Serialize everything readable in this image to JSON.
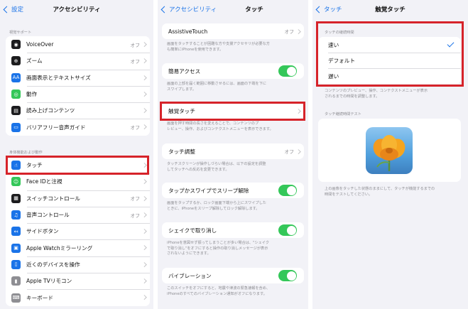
{
  "panel1": {
    "back": "設定",
    "title": "アクセシビリティ",
    "vision_header": "視覚サポート",
    "vision_items": [
      {
        "label": "VoiceOver",
        "value": "オフ",
        "color": "#1c1c1e",
        "icon": "voiceover-icon",
        "glyph": "◉"
      },
      {
        "label": "ズーム",
        "value": "オフ",
        "color": "#1c1c1e",
        "icon": "zoom-icon",
        "glyph": "⊕"
      },
      {
        "label": "画面表示とテキストサイズ",
        "value": "",
        "color": "#1a73e8",
        "icon": "text-size-icon",
        "glyph": "AA"
      },
      {
        "label": "動作",
        "value": "",
        "color": "#34c759",
        "icon": "motion-icon",
        "glyph": "◎"
      },
      {
        "label": "読み上げコンテンツ",
        "value": "",
        "color": "#1c1c1e",
        "icon": "spoken-content-icon",
        "glyph": "▤"
      },
      {
        "label": "バリアフリー音声ガイド",
        "value": "オフ",
        "color": "#1a73e8",
        "icon": "audio-description-icon",
        "glyph": "▭"
      }
    ],
    "physical_header": "身体機能および動作",
    "physical_items": [
      {
        "label": "タッチ",
        "value": "",
        "color": "#1a73e8",
        "icon": "touch-icon",
        "glyph": "☝"
      },
      {
        "label": "Face IDと注視",
        "value": "",
        "color": "#34c759",
        "icon": "face-id-icon",
        "glyph": "☺"
      },
      {
        "label": "スイッチコントロール",
        "value": "オフ",
        "color": "#1c1c1e",
        "icon": "switch-control-icon",
        "glyph": "▦"
      },
      {
        "label": "音声コントロール",
        "value": "オフ",
        "color": "#1a73e8",
        "icon": "voice-control-icon",
        "glyph": "♫"
      },
      {
        "label": "サイドボタン",
        "value": "",
        "color": "#1a73e8",
        "icon": "side-button-icon",
        "glyph": "↤"
      },
      {
        "label": "Apple Watchミラーリング",
        "value": "",
        "color": "#1a73e8",
        "icon": "watch-mirroring-icon",
        "glyph": "▣"
      },
      {
        "label": "近くのデバイスを操作",
        "value": "",
        "color": "#1a73e8",
        "icon": "nearby-devices-icon",
        "glyph": "▯"
      },
      {
        "label": "Apple TVリモコン",
        "value": "",
        "color": "#8e8e93",
        "icon": "tv-remote-icon",
        "glyph": "▮"
      },
      {
        "label": "キーボード",
        "value": "",
        "color": "#8e8e93",
        "icon": "keyboard-icon",
        "glyph": "⌨"
      }
    ]
  },
  "panel2": {
    "back": "アクセシビリティ",
    "title": "タッチ",
    "assistive_touch": {
      "label": "AssistiveTouch",
      "value": "オフ"
    },
    "assistive_touch_desc": [
      "画面をタッチすることが困難な方や支援アクセサリが必要な方",
      "も簡単にiPhoneを使用できます。"
    ],
    "reachability": {
      "label": "簡易アクセス"
    },
    "reachability_desc": [
      "画面の上部を届く範囲に移動させるには、画面の下端を下に",
      "スワイプします。"
    ],
    "haptic_touch": {
      "label": "触覚タッチ"
    },
    "haptic_touch_desc": [
      "画面を押す時間の長さを変えることで、コンテンツのプ",
      "レビュー、操作、およびコンテクストメニューを表示できます。"
    ],
    "touch_accommodations": {
      "label": "タッチ調整",
      "value": "オフ"
    },
    "touch_accommodations_desc": [
      "タッチスクリーンが操作しづらい場合は、以下の設定を調整",
      "してタッチへの反応を変更できます。"
    ],
    "tap_to_wake": {
      "label": "タップかスワイプでスリープ解除"
    },
    "tap_to_wake_desc": [
      "画面をタップするか、ロック画面下端から上にスワイプした",
      "ときに、iPhoneをスリープ解除してロック解除します。"
    ],
    "shake_to_undo": {
      "label": "シェイクで取り消し"
    },
    "shake_to_undo_desc": [
      "iPhoneを意図せず振ってしまうことが多い場合は、\"シェイク",
      "で取り消し\"をオフにすると操作の取り消しメッセージが表示",
      "されないようにできます。"
    ],
    "vibration": {
      "label": "バイブレーション"
    },
    "vibration_desc": [
      "このスイッチをオフにすると、地震や津波の緊急速報を含め、",
      "iPhoneのすべてのバイブレーション通知がオフになります。"
    ]
  },
  "panel3": {
    "back": "タッチ",
    "title": "触覚タッチ",
    "duration_header": "タッチの継続時間",
    "options": [
      "速い",
      "デフォルト",
      "遅い"
    ],
    "selected": "速い",
    "options_desc": [
      "コンテンツのプレビュー、操作、コンテクストメニューが表示",
      "されるまでの時間を調整します。"
    ],
    "test_header": "タッチ継続時間テスト",
    "test_desc": [
      "上の画像をタッチした状態のままにして、タッチが機能するまでの",
      "時間をテストしてください。"
    ]
  },
  "colors": {
    "highlight": "#d6232a",
    "accent": "#1a73e8",
    "toggle_on": "#34c759"
  }
}
